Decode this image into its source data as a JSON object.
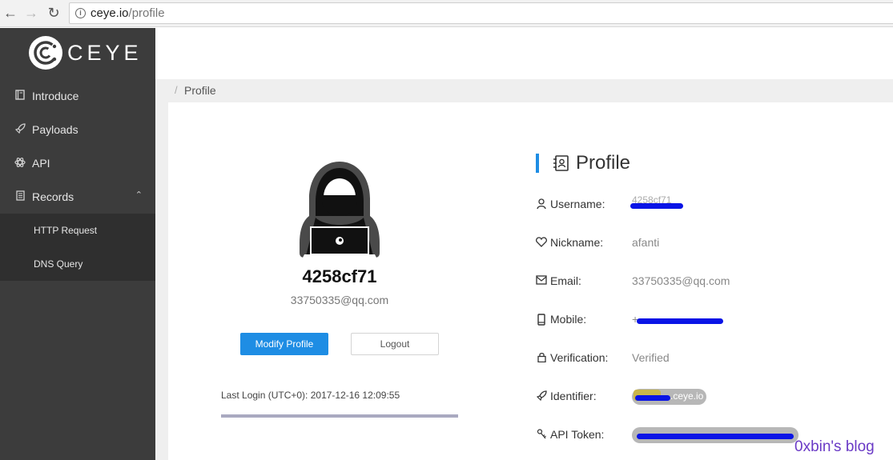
{
  "browser": {
    "url_host": "ceye.io",
    "url_path": "/profile"
  },
  "sidebar": {
    "logo_text": "CEYE",
    "items": [
      {
        "label": "Introduce",
        "icon": "book-icon"
      },
      {
        "label": "Payloads",
        "icon": "rocket-icon"
      },
      {
        "label": "API",
        "icon": "atom-icon"
      },
      {
        "label": "Records",
        "icon": "list-icon"
      }
    ],
    "records_submenu": [
      {
        "label": "HTTP Request"
      },
      {
        "label": "DNS Query"
      }
    ]
  },
  "breadcrumb": {
    "separator": "/",
    "current": "Profile"
  },
  "profile_card": {
    "username": "4258cf71",
    "email": "33750335@qq.com",
    "modify_button": "Modify Profile",
    "logout_button": "Logout",
    "last_login": "Last Login (UTC+0): 2017-12-16 12:09:55"
  },
  "profile_panel": {
    "title": "Profile",
    "fields": {
      "username": {
        "label": "Username:",
        "value": "4258cf71",
        "redacted": true
      },
      "nickname": {
        "label": "Nickname:",
        "value": "afanti"
      },
      "email": {
        "label": "Email:",
        "value": "33750335@qq.com"
      },
      "mobile": {
        "label": "Mobile:",
        "value": "+",
        "redacted": true
      },
      "verification": {
        "label": "Verification:",
        "value": "Verified"
      },
      "identifier": {
        "label": "Identifier:",
        "value": ".ceye.io",
        "redacted": true
      },
      "api_token": {
        "label": "API Token:",
        "redacted": true
      }
    }
  },
  "watermark": "0xbin's blog",
  "colors": {
    "accent": "#1e8de4",
    "sidebar_bg": "#3c3c3c",
    "submenu_bg": "#2f2f2f",
    "redaction": "#0a14e6"
  }
}
